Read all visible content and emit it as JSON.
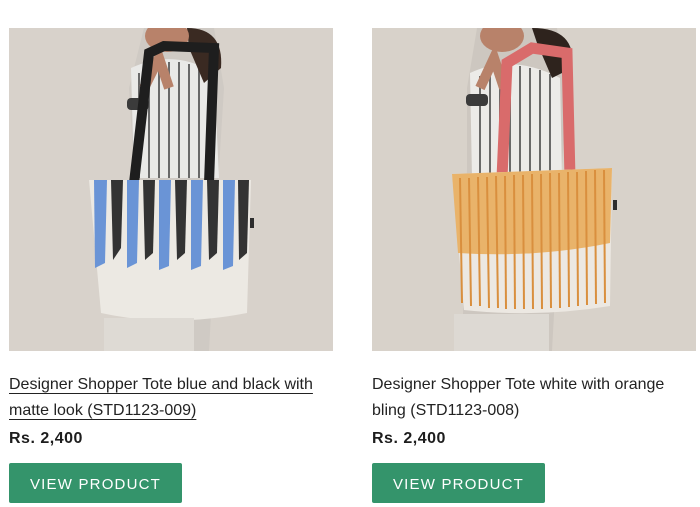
{
  "products": [
    {
      "title": "Designer Shopper Tote blue and black with matte look (STD1123-009)",
      "price": "Rs. 2,400",
      "button_label": "VIEW PRODUCT"
    },
    {
      "title": "Designer Shopper Tote white with orange bling (STD1123-008)",
      "price": "Rs. 2,400",
      "button_label": "VIEW PRODUCT"
    }
  ],
  "colors": {
    "button_bg": "#34946b",
    "button_text": "#ffffff",
    "wall": "#d8d2ca"
  }
}
